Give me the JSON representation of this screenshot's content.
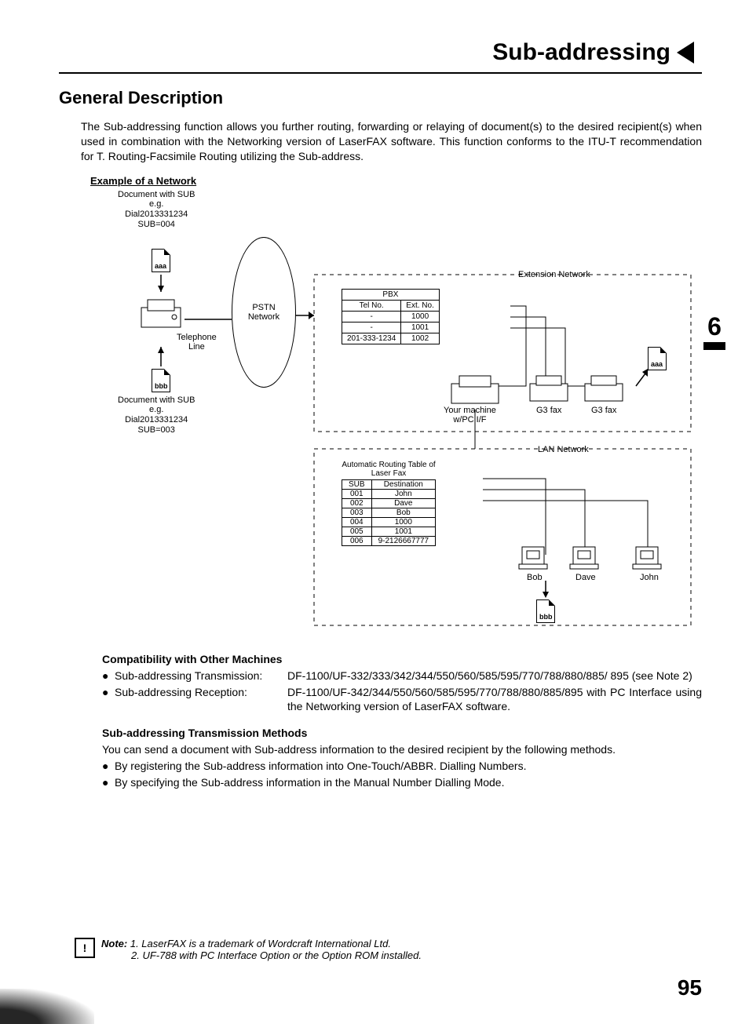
{
  "chapter_title": "Sub-addressing",
  "section_title": "General Description",
  "intro_text": "The Sub-addressing function allows you further routing, forwarding or relaying of document(s) to the desired recipient(s) when used in combination with the Networking version of LaserFAX software. This function conforms to the ITU-T recommendation for T. Routing-Facsimile Routing utilizing the Sub-address.",
  "example_heading": "Example of a Network",
  "diagram": {
    "doc_top": {
      "title": "Document with SUB",
      "eg": "e.g.",
      "dial": "Dial2013331234",
      "sub": "SUB=004",
      "page_label": "aaa"
    },
    "doc_bottom": {
      "title": "Document with SUB",
      "eg": "e.g.",
      "dial": "Dial2013331234",
      "sub": "SUB=003",
      "page_label": "bbb"
    },
    "telephone_line": "Telephone\nLine",
    "pstn": "PSTN\nNetwork",
    "extension_network_label": "Extension Network",
    "pbx_title": "PBX",
    "pbx_headers": [
      "Tel No.",
      "Ext. No."
    ],
    "pbx_rows": [
      [
        "-",
        "1000"
      ],
      [
        "-",
        "1001"
      ],
      [
        "201-333-1234",
        "1002"
      ]
    ],
    "your_machine": "Your machine\nw/PC I/F",
    "g3fax": "G3 fax",
    "aaa_right": "aaa",
    "lan_network_label": "LAN Network",
    "routing_caption": "Automatic Routing Table of Laser Fax",
    "routing_headers": [
      "SUB",
      "Destination"
    ],
    "routing_rows": [
      [
        "001",
        "John"
      ],
      [
        "002",
        "Dave"
      ],
      [
        "003",
        "Bob"
      ],
      [
        "004",
        "1000"
      ],
      [
        "005",
        "1001"
      ],
      [
        "006",
        "9-2126667777"
      ]
    ],
    "pc_labels": [
      "Bob",
      "Dave",
      "John"
    ],
    "bbb_bottom": "bbb"
  },
  "section_number": "6",
  "compat_heading": "Compatibility with Other Machines",
  "compat_tx_label": "Sub-addressing Transmission:",
  "compat_tx_value": "DF-1100/UF-332/333/342/344/550/560/585/595/770/788/880/885/ 895 (see Note 2)",
  "compat_rx_label": "Sub-addressing Reception:",
  "compat_rx_value": "DF-1100/UF-342/344/550/560/585/595/770/788/880/885/895 with PC Interface using the Networking version of LaserFAX software.",
  "methods_heading": "Sub-addressing Transmission Methods",
  "methods_intro": "You can send a document with Sub-address information to the desired recipient by the following methods.",
  "methods_b1": "By registering the Sub-address information into One-Touch/ABBR. Dialling Numbers.",
  "methods_b2": "By specifying the Sub-address information in the Manual Number Dialling Mode.",
  "note_label": "Note:",
  "note_1": "1. LaserFAX is a trademark of Wordcraft International Ltd.",
  "note_2": "2. UF-788 with PC Interface Option or the Option ROM installed.",
  "page_number": "95"
}
